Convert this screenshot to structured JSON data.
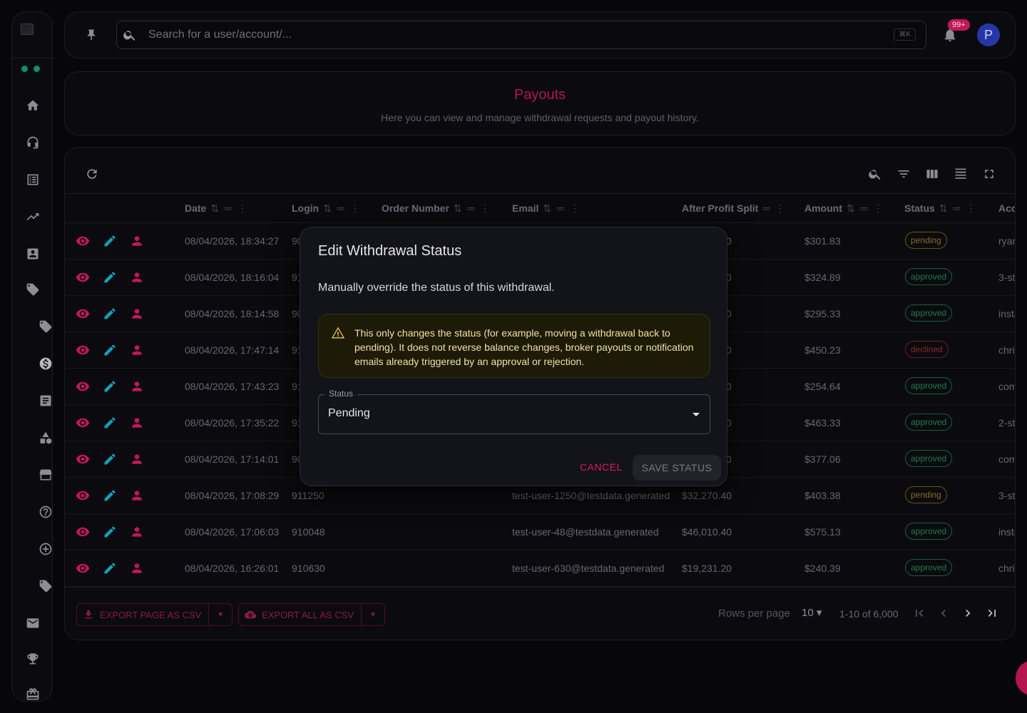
{
  "search": {
    "placeholder": "Search for a user/account/...",
    "shortcut": "⌘K"
  },
  "notifications": {
    "badge": "99+"
  },
  "user": {
    "initial": "P"
  },
  "page": {
    "title": "Payouts",
    "subtitle": "Here you can view and manage withdrawal requests and payout history."
  },
  "table": {
    "columns": [
      "Date",
      "Login",
      "Order Number",
      "Email",
      "After Profit Split",
      "Amount",
      "Status",
      "Acc"
    ],
    "rows": [
      {
        "date": "08/04/2026, 18:34:27",
        "login": "90",
        "email": "",
        "split": "0",
        "amount": "$301.83",
        "status": "pending",
        "acc": "ryar"
      },
      {
        "date": "08/04/2026, 18:16:04",
        "login": "91",
        "email": "",
        "split": "0",
        "amount": "$324.89",
        "status": "approved",
        "acc": "3-st"
      },
      {
        "date": "08/04/2026, 18:14:58",
        "login": "90",
        "email": "",
        "split": "0",
        "amount": "$295.33",
        "status": "approved",
        "acc": "insta"
      },
      {
        "date": "08/04/2026, 17:47:14",
        "login": "91",
        "email": "",
        "split": "0",
        "amount": "$450.23",
        "status": "declined",
        "acc": "chri"
      },
      {
        "date": "08/04/2026, 17:43:23",
        "login": "91",
        "email": "",
        "split": "0",
        "amount": "$254.64",
        "status": "approved",
        "acc": "com"
      },
      {
        "date": "08/04/2026, 17:35:22",
        "login": "91",
        "email": "",
        "split": "0",
        "amount": "$463.33",
        "status": "approved",
        "acc": "2-st"
      },
      {
        "date": "08/04/2026, 17:14:01",
        "login": "90",
        "email": "",
        "split": "0",
        "amount": "$377.06",
        "status": "approved",
        "acc": "com"
      },
      {
        "date": "08/04/2026, 17:08:29",
        "login": "911250",
        "email": "test-user-1250@testdata.generated",
        "split": "$32,270.40",
        "amount": "$403.38",
        "status": "pending",
        "acc": "3-st"
      },
      {
        "date": "08/04/2026, 17:06:03",
        "login": "910048",
        "email": "test-user-48@testdata.generated",
        "split": "$46,010.40",
        "amount": "$575.13",
        "status": "approved",
        "acc": "insta"
      },
      {
        "date": "08/04/2026, 16:26:01",
        "login": "910630",
        "email": "test-user-630@testdata.generated",
        "split": "$19,231.20",
        "amount": "$240.39",
        "status": "approved",
        "acc": "chri"
      }
    ]
  },
  "footer": {
    "export_page": "EXPORT PAGE AS CSV",
    "export_all": "EXPORT ALL AS CSV",
    "rows_per_page_label": "Rows per page",
    "rows_per_page_value": "10",
    "range": "1-10 of 6,000"
  },
  "modal": {
    "title": "Edit Withdrawal Status",
    "description": "Manually override the status of this withdrawal.",
    "warning": "This only changes the status (for example, moving a withdrawal back to pending). It does not reverse balance changes, broker payouts or notification emails already triggered by an approval or rejection.",
    "field_label": "Status",
    "field_value": "Pending",
    "cancel": "CANCEL",
    "save": "SAVE STATUS"
  },
  "colors": {
    "accent": "#d81b60",
    "success": "#0e8f6e",
    "warning": "#e8c65a"
  }
}
